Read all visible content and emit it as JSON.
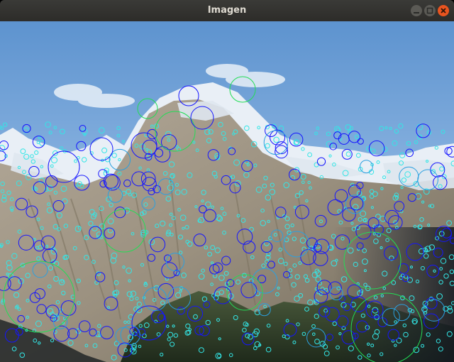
{
  "window": {
    "title": "Imagen",
    "buttons": [
      {
        "name": "minimize-button",
        "icon": "minimize-icon"
      },
      {
        "name": "maximize-button",
        "icon": "maximize-icon"
      },
      {
        "name": "close-button",
        "icon": "close-icon"
      }
    ]
  },
  "image": {
    "subject": "mountain-photo-with-keypoints",
    "colors": {
      "sky_top": "#5f95d0",
      "sky_bottom": "#b9d3ee",
      "snow": "#eef3f8",
      "rock": "#a19787",
      "rock_dark": "#6f6a5e",
      "forest": "#2f3b28",
      "keypoint_cyan": "#33e6e6",
      "keypoint_blue": "#1515ff",
      "keypoint_green": "#22dd55",
      "keypoint_mid": "#2aa0e0"
    }
  }
}
